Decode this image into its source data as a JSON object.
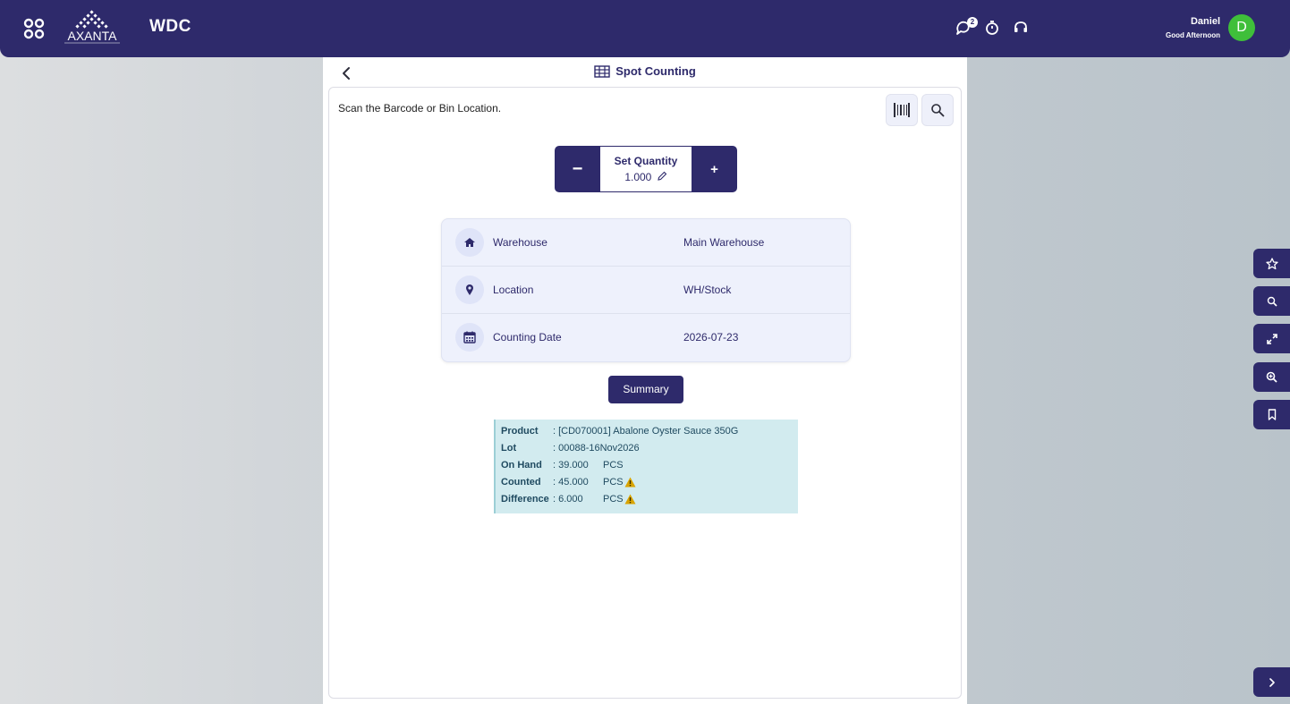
{
  "header": {
    "app_title": "WDC",
    "logo_text": "AXANTA",
    "notification_count": "2",
    "user_name": "Daniel",
    "greeting": "Good Afternoon",
    "avatar_letter": "D",
    "icons": [
      "apps-icon",
      "chat-icon",
      "timer-icon",
      "headset-icon"
    ]
  },
  "panel": {
    "title": "Spot Counting",
    "scan_prompt": "Scan the Barcode or Bin Location."
  },
  "quantity": {
    "label": "Set Quantity",
    "value": "1.000",
    "minus": "−",
    "plus": "+"
  },
  "info": [
    {
      "label": "Warehouse",
      "value": "Main Warehouse",
      "icon": "home-icon"
    },
    {
      "label": "Location",
      "value": "WH/Stock",
      "icon": "map-pin-icon"
    },
    {
      "label": "Counting Date",
      "value": "2026-07-23",
      "icon": "calendar-icon"
    }
  ],
  "summary_button": "Summary",
  "product": {
    "rows": [
      {
        "key": "Product",
        "value": ": [CD070001] Abalone Oyster Sauce 350G",
        "unit": "",
        "warn": false
      },
      {
        "key": "Lot",
        "value": ": 00088-16Nov2026",
        "unit": "",
        "warn": false
      },
      {
        "key": "On Hand",
        "value": ": 39.000",
        "unit": "PCS",
        "warn": false
      },
      {
        "key": "Counted",
        "value": ": 45.000",
        "unit": "PCS",
        "warn": true
      },
      {
        "key": "Difference",
        "value": ": 6.000",
        "unit": "PCS",
        "warn": true
      }
    ]
  },
  "colors": {
    "brand": "#2e2a6b",
    "avatar": "#3fbf3a",
    "info_bg": "#eef1fc",
    "product_bg": "#d2ebef",
    "warning": "#d9a400"
  }
}
